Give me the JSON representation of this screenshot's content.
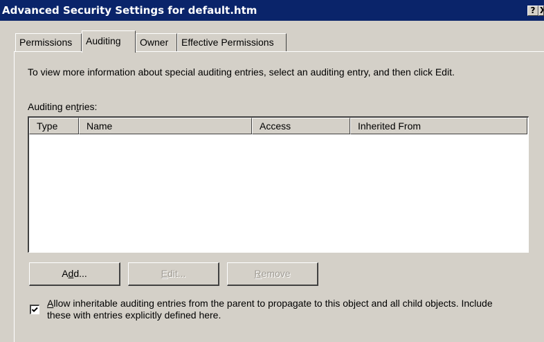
{
  "window": {
    "title": "Advanced Security Settings for default.htm",
    "help_button": "?",
    "close_button": "X"
  },
  "tabs": [
    {
      "label": "Permissions",
      "active": false
    },
    {
      "label": "Auditing",
      "active": true
    },
    {
      "label": "Owner",
      "active": false
    },
    {
      "label": "Effective Permissions",
      "active": false
    }
  ],
  "auditing": {
    "instructions": "To view more information about special auditing entries, select an auditing entry, and then click Edit.",
    "entries_label_pre": "Auditing en",
    "entries_label_accel": "t",
    "entries_label_post": "ries:",
    "columns": [
      "Type",
      "Name",
      "Access",
      "Inherited From"
    ],
    "rows": [],
    "add_button": {
      "pre": "A",
      "accel": "d",
      "post": "d..."
    },
    "edit_button": {
      "pre": "",
      "accel": "E",
      "post": "dit..."
    },
    "remove_button": {
      "pre": "",
      "accel": "R",
      "post": "emove"
    },
    "inherit_checkbox": {
      "checked": true,
      "line1_accel": "A",
      "line1_rest": "llow inheritable auditing entries from the parent to propagate to this object and all child objects. Include",
      "line2": "these with entries explicitly defined here."
    }
  }
}
